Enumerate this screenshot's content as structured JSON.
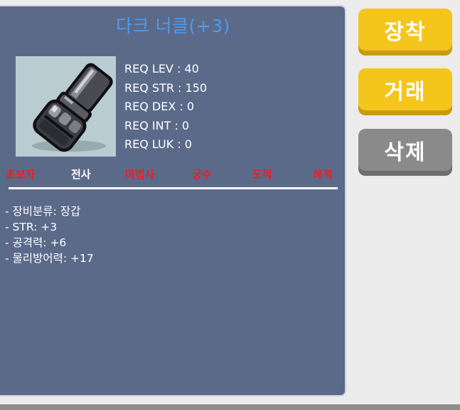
{
  "item": {
    "name": "다크 너클(+3)",
    "icon": "dark-knuckle-glove-icon"
  },
  "requirements": [
    "REQ LEV : 40",
    "REQ STR : 150",
    "REQ DEX : 0",
    "REQ INT : 0",
    "REQ LUK : 0"
  ],
  "jobs": [
    {
      "label": "초보자",
      "color": "#e8202a"
    },
    {
      "label": "전사",
      "color": "#ffffff"
    },
    {
      "label": "마법사",
      "color": "#e8202a"
    },
    {
      "label": "궁수",
      "color": "#e8202a"
    },
    {
      "label": "도적",
      "color": "#e8202a"
    },
    {
      "label": "해적",
      "color": "#e8202a"
    }
  ],
  "stats": [
    "- 장비분류: 장갑",
    "- STR: +3",
    "- 공격력: +6",
    "- 물리방어력: +17"
  ],
  "buttons": {
    "equip": "장착",
    "trade": "거래",
    "delete": "삭제"
  },
  "colors": {
    "title": "#4d9bf0",
    "panel": "#5b6a89",
    "button_yellow": "#f4c51b",
    "button_gray": "#8a8a8a"
  }
}
